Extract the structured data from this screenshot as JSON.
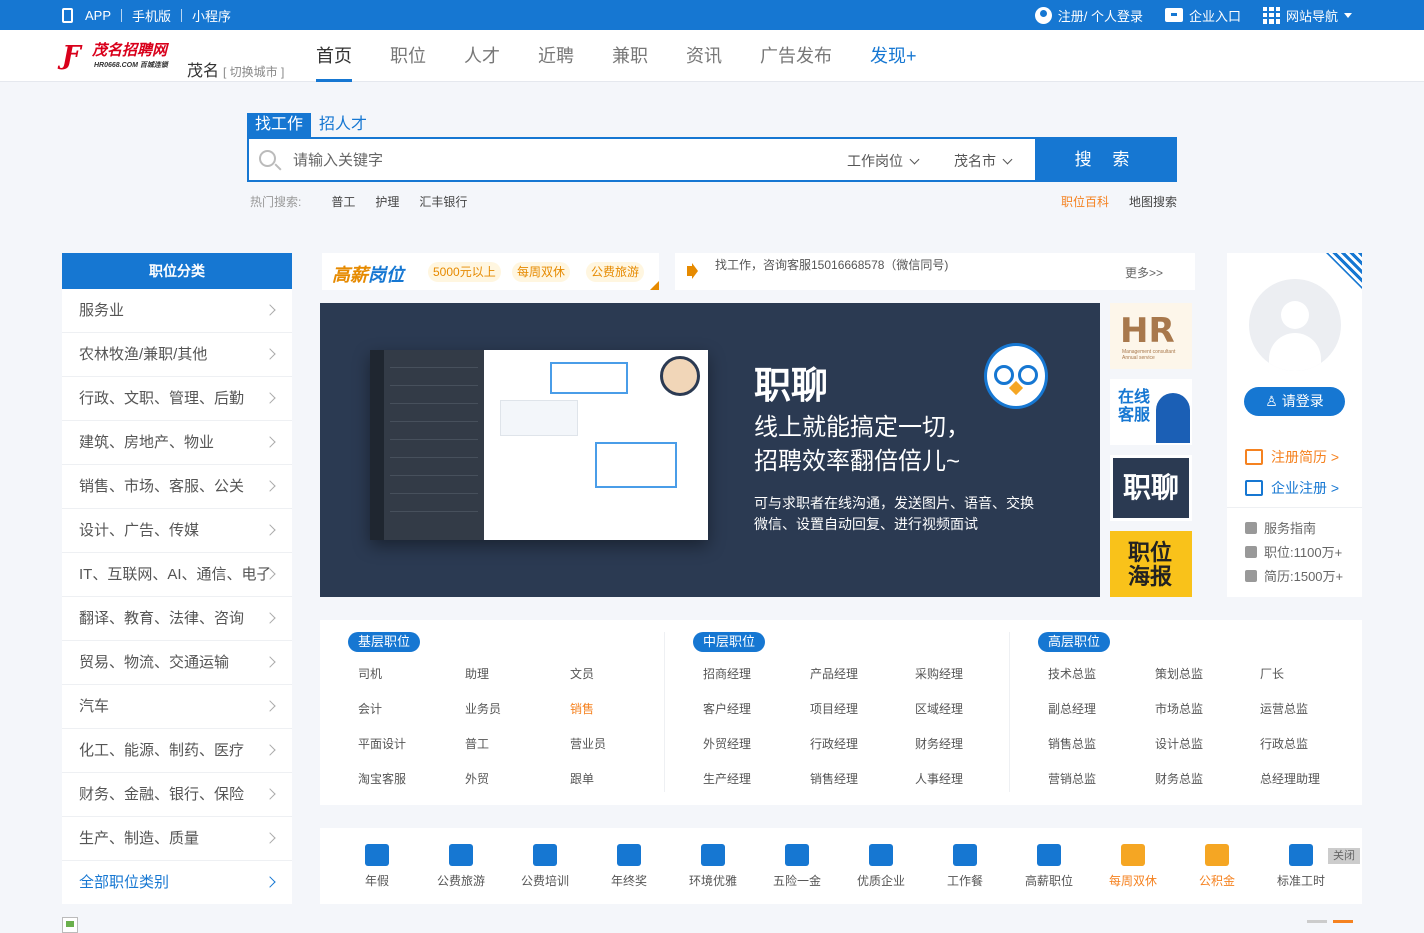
{
  "topbar": {
    "left": [
      "APP",
      "手机版",
      "小程序"
    ],
    "login": "注册/ 个人登录",
    "company": "企业入口",
    "sitenav": "网站导航"
  },
  "brand": {
    "logo_text": "茂名招聘网",
    "logo_sub": "HR0668.COM 百城连锁",
    "city": "茂名",
    "switch_city": "[ 切换城市 ]"
  },
  "nav": [
    "首页",
    "职位",
    "人才",
    "近聘",
    "兼职",
    "资讯",
    "广告发布",
    "发现+"
  ],
  "search": {
    "tabs": [
      "找工作",
      "招人才"
    ],
    "placeholder": "请输入关键字",
    "position_select": "工作岗位",
    "city_select": "茂名市",
    "button": "搜 索",
    "hot_label": "热门搜索:",
    "hot": [
      "普工",
      "护理",
      "汇丰银行"
    ],
    "links": [
      "职位百科",
      "地图搜索"
    ]
  },
  "categories": {
    "title": "职位分类",
    "items": [
      "服务业",
      "农林牧渔/兼职/其他",
      "行政、文职、管理、后勤",
      "建筑、房地产、物业",
      "销售、市场、客服、公关",
      "设计、广告、传媒",
      "IT、互联网、AI、通信、电子",
      "翻译、教育、法律、咨询",
      "贸易、物流、交通运输",
      "汽车",
      "化工、能源、制药、医疗",
      "财务、金融、银行、保险",
      "生产、制造、质量"
    ],
    "all": "全部职位类别"
  },
  "promo": {
    "title_a": "高薪",
    "title_b": "岗位",
    "pills": [
      "5000元以上",
      "每周双休",
      "公费旅游"
    ]
  },
  "notice": {
    "message": "找工作，咨询客服15016668578（微信同号)",
    "more": "更多>>"
  },
  "banner": {
    "title": "职聊",
    "line1": "线上就能搞定一切，",
    "line2": "招聘效率翻倍倍儿~",
    "desc1": "可与求职者在线沟通，发送图片、语音、交换",
    "desc2": "微信、设置自动回复、进行视频面试"
  },
  "tiles": {
    "hr": "HR",
    "hr_sub": "Management consultant Annual service",
    "online_service_1": "在线",
    "online_service_2": "客服",
    "chat": "职聊",
    "poster_1": "职位",
    "poster_2": "海报"
  },
  "login": {
    "button": "请登录",
    "register_resume": "注册简历 >",
    "register_company": "企业注册 >",
    "guide": "服务指南",
    "jobs": "职位:1100万+",
    "resumes": "简历:1500万+"
  },
  "levels": [
    {
      "tag": "基层职位",
      "jobs": [
        "司机",
        "助理",
        "文员",
        "会计",
        "业务员",
        "销售",
        "平面设计",
        "普工",
        "营业员",
        "淘宝客服",
        "外贸",
        "跟单"
      ],
      "highlight_index": 5
    },
    {
      "tag": "中层职位",
      "jobs": [
        "招商经理",
        "产品经理",
        "采购经理",
        "客户经理",
        "项目经理",
        "区域经理",
        "外贸经理",
        "行政经理",
        "财务经理",
        "生产经理",
        "销售经理",
        "人事经理"
      ],
      "highlight_index": -1
    },
    {
      "tag": "高层职位",
      "jobs": [
        "技术总监",
        "策划总监",
        "厂长",
        "副总经理",
        "市场总监",
        "运营总监",
        "销售总监",
        "设计总监",
        "行政总监",
        "营销总监",
        "财务总监",
        "总经理助理"
      ],
      "highlight_index": -1
    }
  ],
  "benefits": {
    "items": [
      "年假",
      "公费旅游",
      "公费培训",
      "年终奖",
      "环境优雅",
      "五险一金",
      "优质企业",
      "工作餐",
      "高薪职位",
      "每周双休",
      "公积金",
      "标准工时"
    ],
    "orange": [
      9,
      10
    ],
    "close": "关闭"
  },
  "colors": {
    "primary": "#1677d2",
    "accent": "#f58220"
  }
}
